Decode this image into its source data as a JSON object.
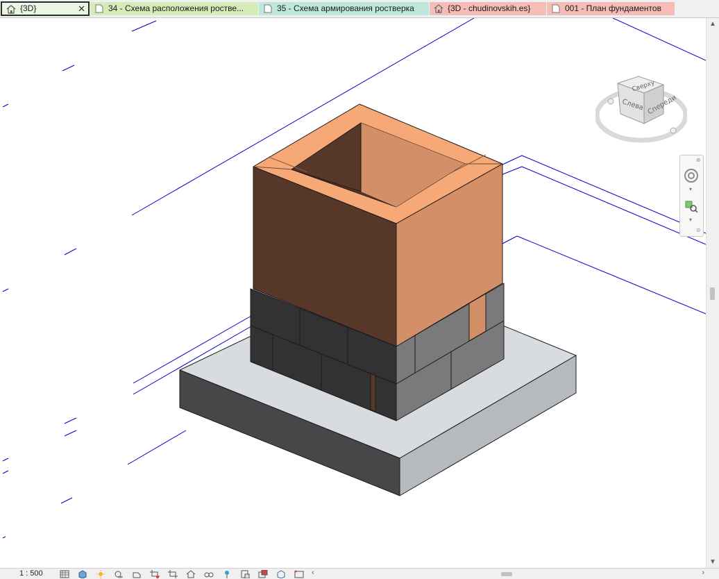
{
  "tabs": [
    {
      "label": "{3D}",
      "kind": "3d",
      "active": true,
      "close": "✕"
    },
    {
      "label": "34 - Схема расположения ростве...",
      "kind": "sheet",
      "color": "#d5ecb8"
    },
    {
      "label": "35 - Схема армирования ростверка",
      "kind": "sheet",
      "color": "#bfe8dd"
    },
    {
      "label": "{3D - chudinovskih.es}",
      "kind": "3d",
      "color": "#f6bcb7"
    },
    {
      "label": "001 - План фундаментов",
      "kind": "sheet",
      "color": "#f6bcb7"
    }
  ],
  "viewcube": {
    "face_front": "Спереди",
    "face_left": "Слева",
    "face_top": "Сверху"
  },
  "navbar": {
    "items": [
      "steering-wheel",
      "zoom-region"
    ]
  },
  "statusbar": {
    "scale": "1 : 500",
    "icons": [
      "detail-level",
      "visual-style",
      "sun-path",
      "shadows",
      "render",
      "crop-view",
      "show-crop",
      "unlock-3d",
      "temporary-hide",
      "reveal-hidden",
      "lock-view",
      "highlight",
      "worksharing",
      "analytical-model",
      "constraints"
    ]
  },
  "model_colors": {
    "brick_top": "#f7a877",
    "brick_right": "#d39068",
    "brick_left": "#573828",
    "block_left": "#323232",
    "block_right": "#7a7a7a",
    "slab_top": "#d8dce0",
    "slab_right": "#b6b9bd",
    "slab_left": "#474749",
    "grid_line": "#0000cc"
  }
}
